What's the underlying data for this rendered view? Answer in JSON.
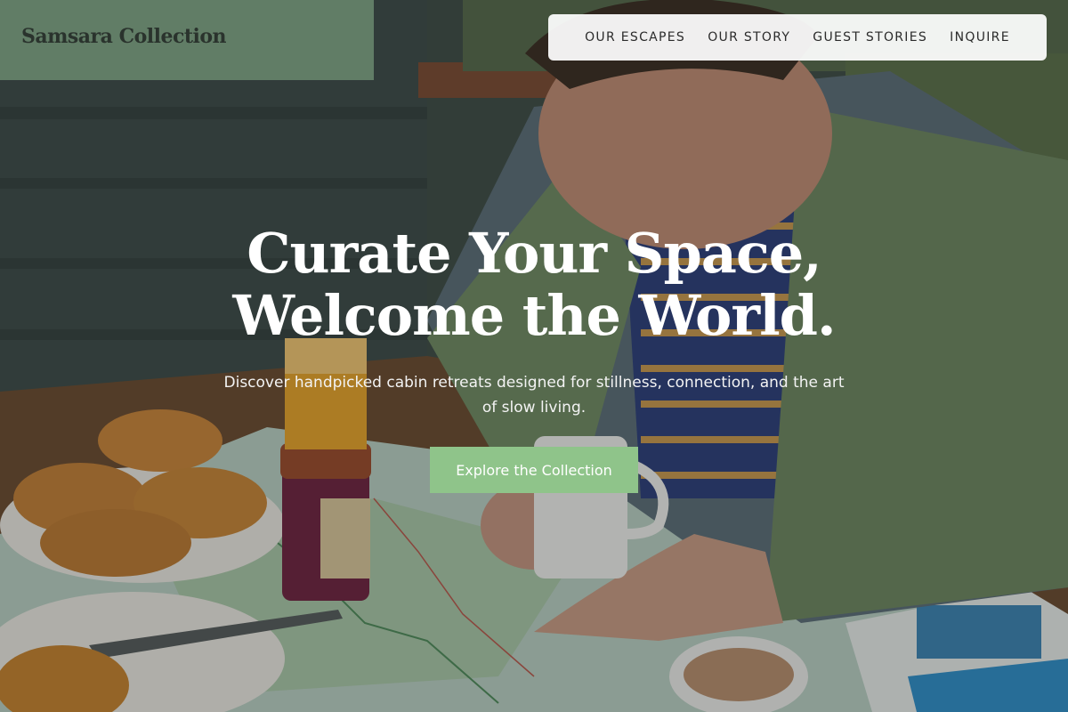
{
  "brand": {
    "name": "Samsara Collection"
  },
  "nav": {
    "items": [
      {
        "label": "OUR ESCAPES"
      },
      {
        "label": "OUR STORY"
      },
      {
        "label": "GUEST STORIES"
      },
      {
        "label": "INQUIRE"
      }
    ]
  },
  "hero": {
    "title_line1": "Curate Your Space,",
    "title_line2": "Welcome the World.",
    "subtitle": "Discover handpicked cabin retreats designed for stillness, connection, and the art of slow living.",
    "cta_label": "Explore the Collection"
  },
  "colors": {
    "cta_background": "#8fc48a",
    "nav_background": "#ffffff",
    "brand_text": "#2a332d"
  }
}
